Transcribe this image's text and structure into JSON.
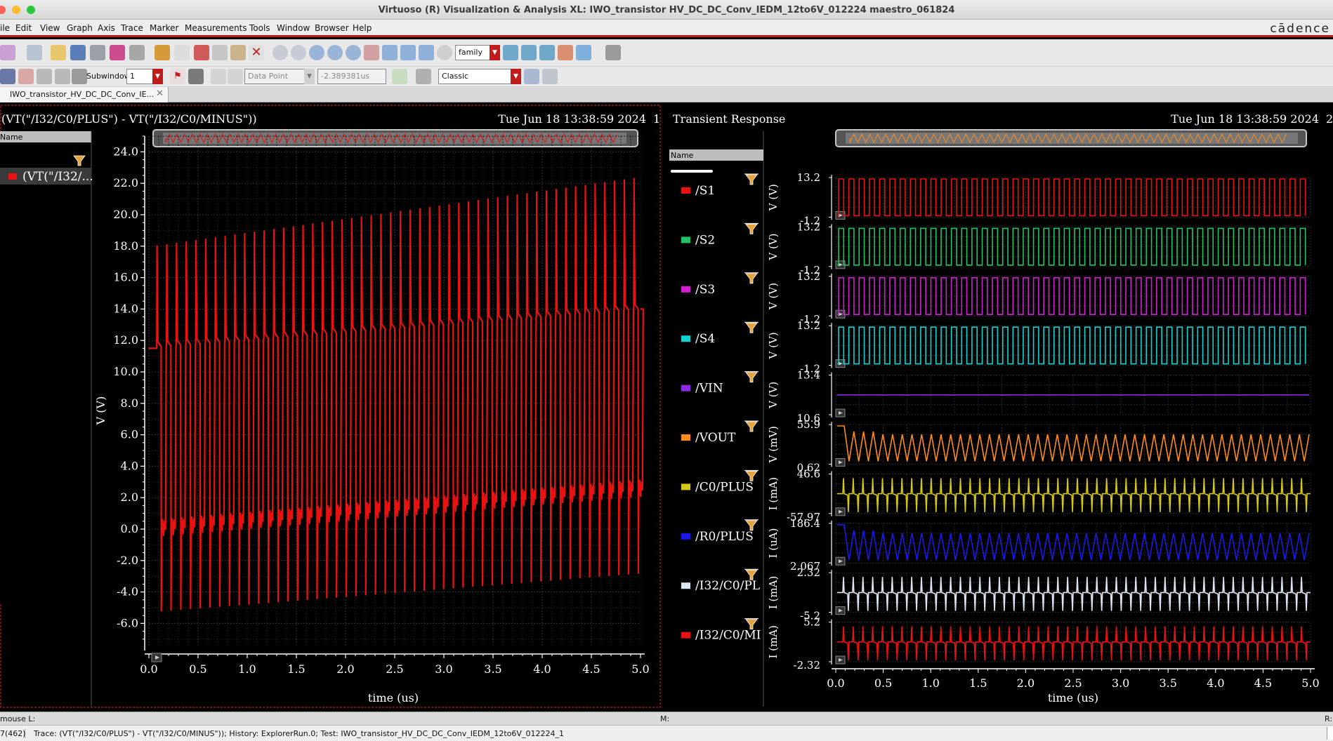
{
  "window": {
    "title": "Virtuoso (R) Visualization & Analysis XL: IWO_transistor HV_DC_DC_Conv_IEDM_12to6V_012224 maestro_061824"
  },
  "menu": [
    "ile",
    "Edit",
    "View",
    "Graph",
    "Axis",
    "Trace",
    "Marker",
    "Measurements",
    "Tools",
    "Window",
    "Browser",
    "Help"
  ],
  "brand": "cādence",
  "toolbar": {
    "family_select": "family",
    "subwindow_label": "Subwindow:",
    "subwindow_value": "1",
    "data_point_select": "Data Point",
    "data_point_value": "-2.389381us",
    "style_select": "Classic"
  },
  "tab": {
    "label": "IWO_transistor_HV_DC_DC_Conv_IE..."
  },
  "left": {
    "title": "(VT(\"/I32/C0/PLUS\") - VT(\"/I32/C0/MINUS\"))",
    "date": "Tue Jun 18 13:38:59 2024",
    "date_suffix": "1",
    "browser_header": "Name",
    "trace_label": "(VT(\"/I32/..."
  },
  "right": {
    "title": "Transient Response",
    "date": "Tue Jun 18 13:38:59 2024",
    "date_suffix": "2",
    "browser_header": "Name"
  },
  "status": {
    "mouse": "mouse L:",
    "m": "M:",
    "r": "R:"
  },
  "bottom": {
    "count": "7(462)",
    "message": "Trace: (VT(\"/I32/C0/PLUS\") - VT(\"/I32/C0/MINUS\")); History: ExplorerRun.0; Test: IWO_transistor_HV_DC_DC_Conv_IEDM_12to6V_012224_1"
  },
  "colors": {
    "red": "#e81212",
    "grid": "#2c2c2c",
    "axis": "#ffffff",
    "accent": "#c21b1b"
  },
  "chart_data": [
    {
      "type": "line",
      "title": "(VT(\"/I32/C0/PLUS\") - VT(\"/I32/C0/MINUS\"))",
      "xlabel": "time (us)",
      "ylabel": "V (V)",
      "xlim": [
        0.0,
        5.0
      ],
      "ylim": [
        -7.5,
        25.0
      ],
      "xticks": [
        "0.0",
        "0.5",
        "1.0",
        "1.5",
        "2.0",
        "2.5",
        "3.0",
        "3.5",
        "4.0",
        "4.5",
        "5.0"
      ],
      "yticks": [
        "24.0",
        "22.0",
        "20.0",
        "18.0",
        "16.0",
        "14.0",
        "12.0",
        "10.0",
        "8.0",
        "6.0",
        "4.0",
        "2.0",
        "0.0",
        "-2.0",
        "-4.0",
        "-6.0"
      ],
      "series": [
        {
          "name": "(VT(\"/I32/...",
          "color": "#e81212",
          "waveform": {
            "pulses": 50,
            "start_level": 11.5,
            "plateau_start": 11.6,
            "plateau_end": 14.0,
            "peak_start": 18.0,
            "peak_end": 22.3,
            "low_start": 0.0,
            "low_end": 2.5,
            "trough_start": -5.2,
            "trough_end": -2.8,
            "end_value": 14.0
          }
        }
      ]
    },
    {
      "type": "line",
      "title": "Transient Response",
      "xlabel": "time (us)",
      "xlim": [
        0.0,
        5.0
      ],
      "xticks": [
        "0.0",
        "0.5",
        "1.0",
        "1.5",
        "2.0",
        "2.5",
        "3.0",
        "3.5",
        "4.0",
        "4.5",
        "5.0"
      ],
      "strips": [
        {
          "name": "/S1",
          "color": "#e81212",
          "ylabel": "V (V)",
          "ymax": "13.2",
          "ymin": "-1.2",
          "shape": "square"
        },
        {
          "name": "/S2",
          "color": "#21c264",
          "ylabel": "V (V)",
          "ymax": "13.2",
          "ymin": "-1.2",
          "shape": "square"
        },
        {
          "name": "/S3",
          "color": "#d21ed2",
          "ylabel": "V (V)",
          "ymax": "13.2",
          "ymin": "-1.2",
          "shape": "square"
        },
        {
          "name": "/S4",
          "color": "#12d2d2",
          "ylabel": "V (V)",
          "ymax": "13.2",
          "ymin": "-1.2",
          "shape": "square"
        },
        {
          "name": "/VIN",
          "color": "#8a2be2",
          "ylabel": "V (V)",
          "ymax": "13.4",
          "ymin": "10.6",
          "shape": "flat"
        },
        {
          "name": "/VOUT",
          "color": "#ff8c1a",
          "ylabel": "V (mV)",
          "ymax": "55.9",
          "ymin": "0.62",
          "shape": "triangle"
        },
        {
          "name": "/C0/PLUS",
          "color": "#d4c814",
          "ylabel": "I (mA)",
          "ymax": "46.6",
          "ymin": "-57.97",
          "shape": "spike"
        },
        {
          "name": "/R0/PLUS",
          "color": "#1a1ae8",
          "ylabel": "I (uA)",
          "ymax": "186.4",
          "ymin": "2.067",
          "shape": "triangle"
        },
        {
          "name": "/I32/C0/PL",
          "color": "#dde4f2",
          "ylabel": "I (mA)",
          "ymax": "2.32",
          "ymin": "-5.2",
          "shape": "spike"
        },
        {
          "name": "/I32/C0/MI",
          "color": "#e81212",
          "ylabel": "I (mA)",
          "ymax": "5.2",
          "ymin": "-2.32",
          "shape": "spike"
        }
      ]
    }
  ]
}
